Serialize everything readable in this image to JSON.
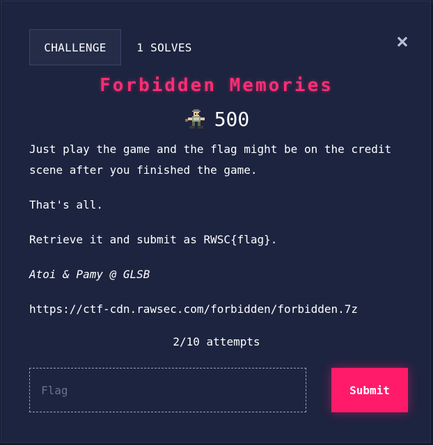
{
  "modal": {
    "tabs": [
      {
        "label": "CHALLENGE",
        "active": true
      },
      {
        "label": "1 SOLVES",
        "active": false
      }
    ],
    "close_icon": "close-icon"
  },
  "challenge": {
    "title": "Forbidden Memories",
    "points": "500",
    "points_icon": "pixel-sprite-icon",
    "description": {
      "p1": "Just play the game and the flag might be on the credit scene after you finished the game.",
      "p2": "That's all.",
      "p3": "Retrieve it and submit as RWSC{flag}.",
      "author": "Atoi & Pamy @ GLSB",
      "link": "https://ctf-cdn.rawsec.com/forbidden/forbidden.7z"
    },
    "attempts": "2/10 attempts"
  },
  "form": {
    "flag_placeholder": "Flag",
    "flag_value": "",
    "submit_label": "Submit"
  },
  "colors": {
    "background": "#1d2440",
    "accent": "#ff1b69",
    "title": "#ff2d74",
    "text": "#ffffff"
  }
}
